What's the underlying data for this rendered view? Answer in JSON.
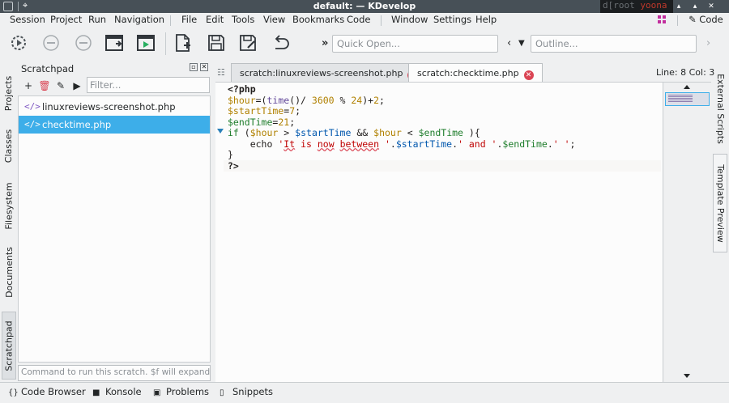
{
  "window": {
    "title": "default:  — KDevelop",
    "terminal_text_user": "d[root",
    "terminal_text_host": "yoona"
  },
  "menubar": {
    "left": [
      "Session",
      "Project",
      "Run",
      "Navigation"
    ],
    "right": [
      "File",
      "Edit",
      "Tools",
      "View",
      "Bookmarks",
      "Code",
      "Window",
      "Settings",
      "Help"
    ],
    "area_switch": "Code"
  },
  "toolbar": {
    "quick_open_placeholder": "Quick Open...",
    "outline_placeholder": "Outline...",
    "overflow": "»"
  },
  "left_tabs": [
    "Projects",
    "Classes",
    "Filesystem",
    "Documents",
    "Scratchpad"
  ],
  "right_tabs": [
    "External Scripts",
    "Template Preview"
  ],
  "scratchpad": {
    "title": "Scratchpad",
    "filter_placeholder": "Filter...",
    "files": [
      {
        "name": "linuxreviews-screenshot.php",
        "icon": "</>",
        "selected": false
      },
      {
        "name": "checktime.php",
        "icon": "</>",
        "selected": true
      }
    ],
    "command_placeholder": "Command to run this scratch. $f will expand to"
  },
  "editor": {
    "tabs": [
      {
        "label": "scratch:linuxreviews-screenshot.php",
        "active": false
      },
      {
        "label": "scratch:checktime.php",
        "active": true
      }
    ],
    "cursor_position": "Line: 8 Col: 3"
  },
  "bottom_tabs": [
    {
      "label": "Code Browser",
      "icon": "{}"
    },
    {
      "label": "Konsole",
      "icon": "■"
    },
    {
      "label": "Problems",
      "icon": "▣"
    },
    {
      "label": "Snippets",
      "icon": "▯"
    }
  ],
  "colors": {
    "accent": "#3daee9",
    "titlebar": "#475057",
    "close_badge": "#da4453"
  }
}
